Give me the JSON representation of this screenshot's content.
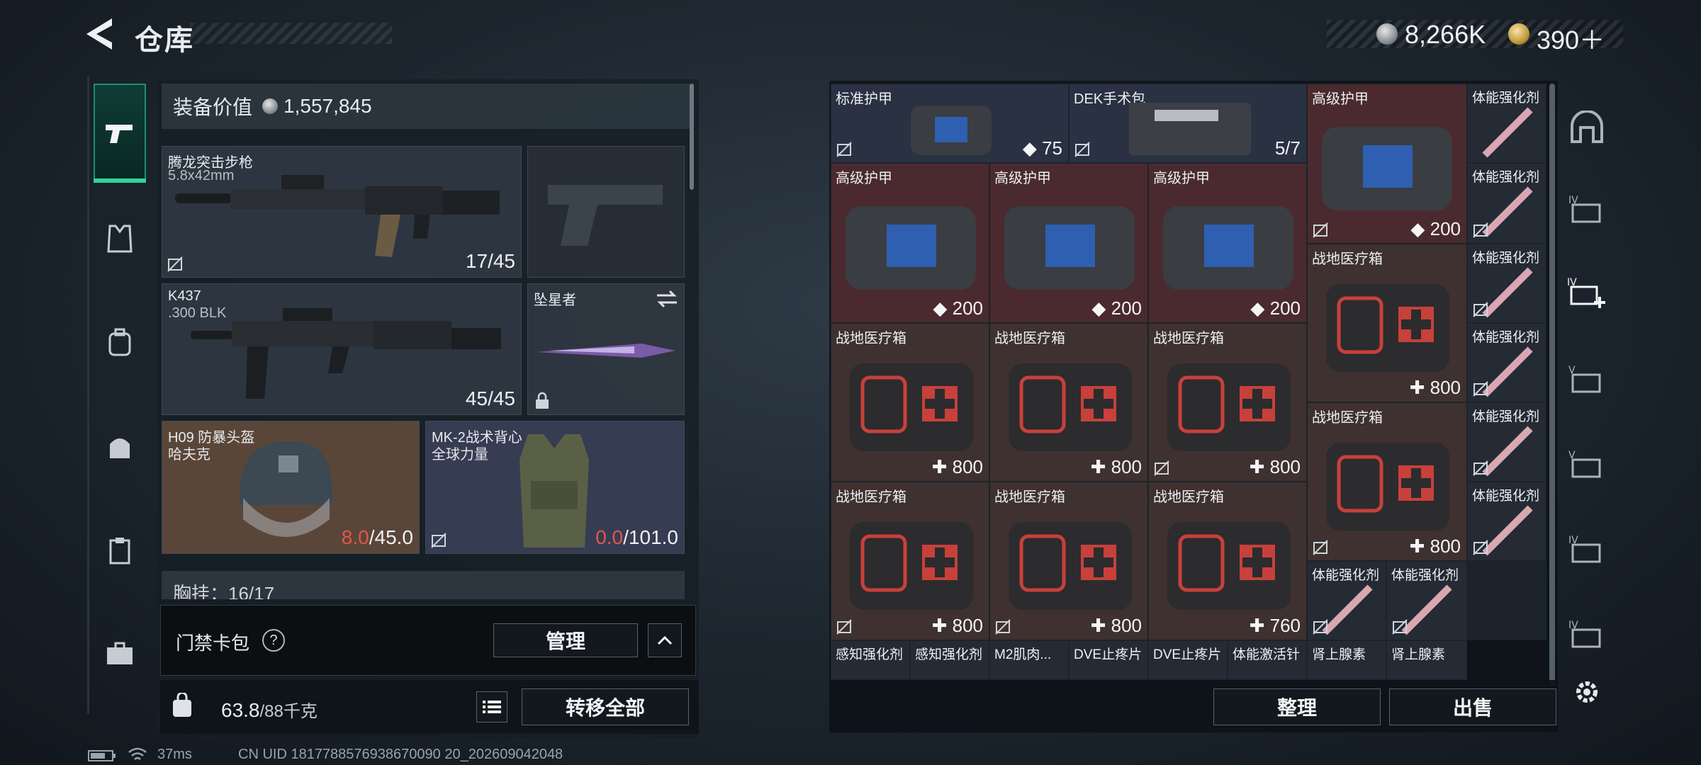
{
  "header": {
    "title": "仓库",
    "currency_silver": "8,266K",
    "currency_gold": "390＋"
  },
  "nav": {
    "items": [
      "weapon-icon",
      "vest-icon",
      "backpack-icon",
      "bag-icon",
      "clipboard-icon",
      "briefcase-icon"
    ]
  },
  "loadout": {
    "equip_value_label": "装备价值",
    "equip_value": "1,557,845",
    "primary": {
      "name": "腾龙突击步枪",
      "caliber": "5.8x42mm",
      "ammo": "17/45"
    },
    "secondary": {
      "name": "K437",
      "caliber": ".300 BLK",
      "ammo": "45/45"
    },
    "melee": {
      "name": "坠星者"
    },
    "helmet": {
      "name": "H09 防暴头盔",
      "brand": "哈夫克",
      "cur": "8.0",
      "max": "/45.0"
    },
    "armor": {
      "name": "MK-2战术背心",
      "brand": "全球力量",
      "cur": "0.0",
      "max": "/101.0"
    },
    "chest_rig_partial": "胸挂：16/17",
    "keycard_label": "门禁卡包",
    "manage_label": "管理",
    "weight": "63.8",
    "weight_cap": "/88千克",
    "transfer_all_label": "转移全部"
  },
  "stash": {
    "row1": [
      {
        "name": "标准护甲",
        "val": "75"
      },
      {
        "name": "DEK手术包",
        "val": "5/7"
      },
      {
        "name": "高级护甲",
        "val": "200"
      }
    ],
    "armor_row": [
      {
        "name": "高级护甲",
        "val": "200"
      },
      {
        "name": "高级护甲",
        "val": "200"
      },
      {
        "name": "高级护甲",
        "val": "200"
      }
    ],
    "med_row1": [
      {
        "name": "战地医疗箱",
        "val": "800"
      },
      {
        "name": "战地医疗箱",
        "val": "800"
      },
      {
        "name": "战地医疗箱",
        "val": "800"
      }
    ],
    "med_row2": [
      {
        "name": "战地医疗箱",
        "val": "800"
      },
      {
        "name": "战地医疗箱",
        "val": "800"
      },
      {
        "name": "战地医疗箱",
        "val": "760"
      }
    ],
    "col4_meds": [
      {
        "name": "战地医疗箱",
        "val": "800"
      },
      {
        "name": "战地医疗箱",
        "val": "800"
      }
    ],
    "stim_label": "体能强化剂",
    "bottom_row": [
      "感知强化剂",
      "感知强化剂",
      "M2肌肉...",
      "DVE止疼片",
      "DVE止疼片",
      "体能激活针",
      "肾上腺素",
      "肾上腺素"
    ],
    "sort_label": "整理",
    "sell_label": "出售"
  },
  "status": {
    "ping": "37ms",
    "uid": "CN UID 1817788576938670090 20_202609042048"
  }
}
